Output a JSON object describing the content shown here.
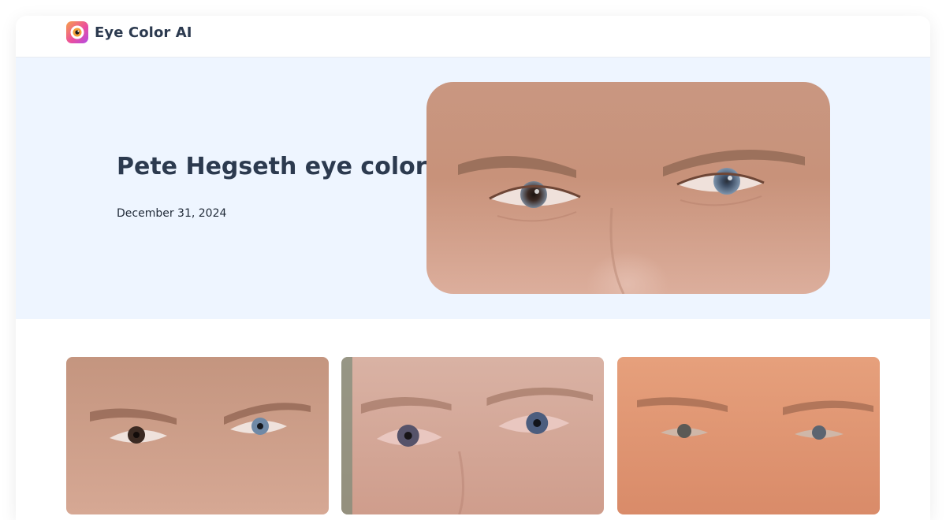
{
  "header": {
    "brand_name": "Eye Color AI",
    "logo_icon": "eye-icon",
    "logo_colors": [
      "#f5a24b",
      "#e84ea0",
      "#b44be3"
    ]
  },
  "hero": {
    "title": "Pete Hegseth eye color",
    "date": "December 31, 2024",
    "image": "eyes-closeup-photo"
  },
  "gallery": {
    "items": [
      {
        "image": "eyes-closeup-photo-1"
      },
      {
        "image": "eyes-closeup-photo-2"
      },
      {
        "image": "eyes-closeup-photo-3"
      }
    ]
  },
  "colors": {
    "hero_background": "#eef5ff",
    "title_color": "#2c3a4f",
    "page_background": "#ffffff"
  }
}
